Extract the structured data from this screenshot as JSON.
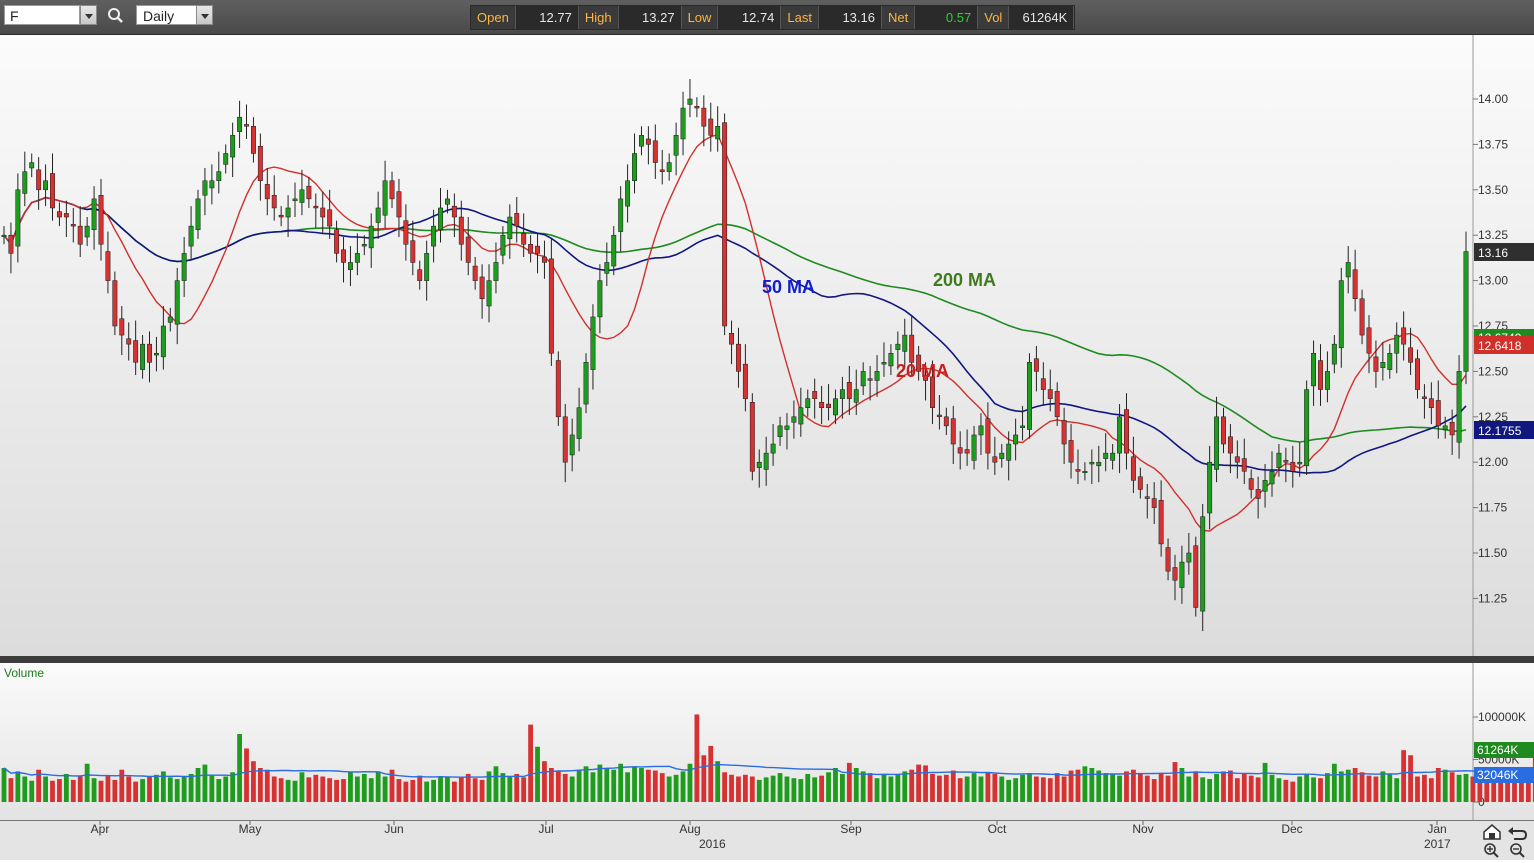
{
  "toolbar": {
    "symbol": "F",
    "period": "Daily",
    "quote": [
      {
        "label": "Open",
        "value": "12.77"
      },
      {
        "label": "High",
        "value": "13.27"
      },
      {
        "label": "Low",
        "value": "12.74"
      },
      {
        "label": "Last",
        "value": "13.16"
      },
      {
        "label": "Net",
        "value": "0.57",
        "positive": true
      },
      {
        "label": "Vol",
        "value": "61264K"
      }
    ]
  },
  "colors": {
    "up": "#1e9c1e",
    "down": "#d63232",
    "ma20": "#d0302a",
    "ma50": "#101880",
    "ma200": "#1f8a1f",
    "vol_avg": "#2a6de0"
  },
  "chart_data": [
    {
      "type": "candlestick",
      "title": "",
      "price_labels": [
        {
          "text": "50 MA",
          "color": "#1020d0"
        },
        {
          "text": "200 MA",
          "color": "#3f7a1f"
        },
        {
          "text": "20 MA",
          "color": "#c81e1e"
        }
      ],
      "y_ticks": [
        "14.00",
        "13.75",
        "13.50",
        "13.25",
        "13.00",
        "12.75",
        "12.50",
        "12.25",
        "12.00",
        "11.75",
        "11.50",
        "11.25"
      ],
      "ylim": [
        11.0,
        14.27
      ],
      "x_ticks": [
        "Apr",
        "May",
        "Jun",
        "Jul",
        "Aug",
        "Sep",
        "Oct",
        "Nov",
        "Dec",
        "Jan"
      ],
      "x_year_labels": [
        "2016",
        "2017"
      ],
      "markers": {
        "last": "13.16",
        "ma200": "12.6749",
        "ma20": "12.6418",
        "ma50": "12.1755"
      },
      "close": [
        13.25,
        13.15,
        13.5,
        13.6,
        13.65,
        13.5,
        13.55,
        13.4,
        13.35,
        13.35,
        13.3,
        13.2,
        13.3,
        13.45,
        13.2,
        13.0,
        12.75,
        12.7,
        12.65,
        12.55,
        12.65,
        12.55,
        12.6,
        12.75,
        12.8,
        13.0,
        13.15,
        13.3,
        13.45,
        13.55,
        13.55,
        13.6,
        13.7,
        13.8,
        13.9,
        13.85,
        13.7,
        13.55,
        13.45,
        13.4,
        13.35,
        13.4,
        13.45,
        13.5,
        13.45,
        13.4,
        13.35,
        13.3,
        13.15,
        13.1,
        13.1,
        13.15,
        13.2,
        13.3,
        13.4,
        13.55,
        13.45,
        13.35,
        13.2,
        13.1,
        13.0,
        13.15,
        13.3,
        13.4,
        13.45,
        13.35,
        13.2,
        13.1,
        13.0,
        12.9,
        13.0,
        13.1,
        13.25,
        13.35,
        13.3,
        13.2,
        13.15,
        13.15,
        13.1,
        12.6,
        12.25,
        12.0,
        12.15,
        12.3,
        12.55,
        12.8,
        13.0,
        13.1,
        13.25,
        13.45,
        13.55,
        13.7,
        13.8,
        13.75,
        13.65,
        13.6,
        13.65,
        13.8,
        13.95,
        14.0,
        13.95,
        13.85,
        13.8,
        13.85,
        12.75,
        12.65,
        12.5,
        12.35,
        11.95,
        12.0,
        12.05,
        12.1,
        12.2,
        12.2,
        12.25,
        12.3,
        12.35,
        12.35,
        12.3,
        12.3,
        12.35,
        12.4,
        12.35,
        12.4,
        12.5,
        12.45,
        12.5,
        12.55,
        12.6,
        12.65,
        12.7,
        12.55,
        12.5,
        12.45,
        12.3,
        12.25,
        12.2,
        12.1,
        12.05,
        12.05,
        12.15,
        12.2,
        12.05,
        12.0,
        12.05,
        12.1,
        12.15,
        12.2,
        12.55,
        12.5,
        12.4,
        12.35,
        12.25,
        12.1,
        12.0,
        11.95,
        11.95,
        12.0,
        12.0,
        12.05,
        12.05,
        12.25,
        12.05,
        11.9,
        11.85,
        11.8,
        11.75,
        11.55,
        11.4,
        11.35,
        11.45,
        11.5,
        11.2,
        11.7,
        12.0,
        12.25,
        12.1,
        12.05,
        12.0,
        11.95,
        11.85,
        11.8,
        11.9,
        11.95,
        12.05,
        12.0,
        11.95,
        12.0,
        12.4,
        12.6,
        12.4,
        12.5,
        12.65,
        13.0,
        13.1,
        12.9,
        12.7,
        12.6,
        12.5,
        12.55,
        12.6,
        12.7,
        12.65,
        12.55,
        12.4,
        12.35,
        12.3,
        12.2,
        12.2,
        12.15,
        12.5,
        13.16
      ],
      "volume_panel": {
        "label": "Volume",
        "y_ticks": [
          "100000K",
          "50000K",
          "0"
        ],
        "markers": {
          "last_volume": "61264K",
          "avg_volume": "32046K"
        },
        "volumes_k": [
          40,
          28,
          36,
          30,
          25,
          38,
          30,
          25,
          27,
          33,
          26,
          30,
          45,
          28,
          25,
          31,
          26,
          38,
          30,
          24,
          27,
          30,
          32,
          36,
          29,
          27,
          30,
          33,
          40,
          44,
          31,
          27,
          30,
          35,
          80,
          63,
          48,
          40,
          38,
          30,
          28,
          26,
          25,
          35,
          29,
          32,
          30,
          28,
          26,
          27,
          35,
          30,
          33,
          28,
          36,
          30,
          38,
          27,
          24,
          26,
          31,
          24,
          26,
          29,
          30,
          24,
          30,
          33,
          28,
          26,
          36,
          42,
          34,
          30,
          33,
          29,
          91,
          65,
          48,
          40,
          36,
          33,
          30,
          38,
          42,
          35,
          44,
          40,
          38,
          45,
          35,
          42,
          40,
          38,
          37,
          34,
          30,
          32,
          36,
          45,
          103,
          55,
          66,
          48,
          35,
          32,
          30,
          32,
          30,
          26,
          29,
          31,
          34,
          30,
          28,
          27,
          33,
          29,
          31,
          35,
          40,
          33,
          46,
          40,
          36,
          34,
          28,
          32,
          30,
          32,
          36,
          38,
          44,
          43,
          33,
          31,
          32,
          37,
          28,
          30,
          34,
          30,
          35,
          33,
          30,
          26,
          28,
          32,
          34,
          30,
          29,
          28,
          34,
          30,
          37,
          38,
          42,
          40,
          37,
          34,
          33,
          31,
          36,
          38,
          34,
          31,
          27,
          34,
          31,
          47,
          40,
          30,
          36,
          29,
          27,
          33,
          36,
          37,
          28,
          34,
          31,
          29,
          46,
          32,
          28,
          26,
          24,
          30,
          33,
          29,
          28,
          34,
          45,
          36,
          38,
          40,
          35,
          31,
          30,
          36,
          33,
          28,
          61,
          55,
          30,
          32,
          28,
          40,
          38,
          35,
          32,
          33,
          30,
          26,
          28,
          24,
          26,
          31,
          34,
          30,
          36,
          61
        ],
        "avg_k": 32
      }
    }
  ],
  "nav": {
    "home_icon": "home-icon",
    "undo_icon": "undo-icon",
    "zoom_in_icon": "zoom-in-icon",
    "zoom_out_icon": "zoom-out-icon"
  }
}
